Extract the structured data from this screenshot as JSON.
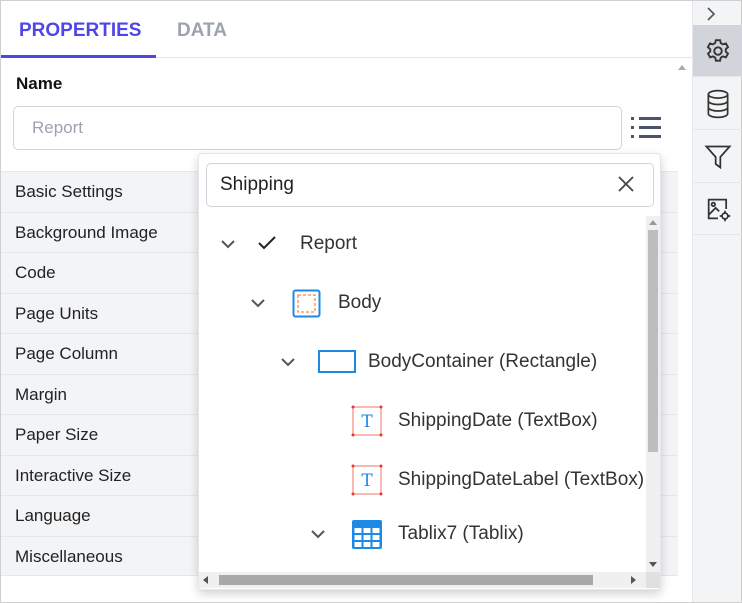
{
  "tabs": [
    {
      "label": "PROPERTIES",
      "active": true
    },
    {
      "label": "DATA",
      "active": false
    }
  ],
  "name_section": {
    "label": "Name",
    "input_placeholder": "Report"
  },
  "property_categories": [
    "Basic Settings",
    "Background Image",
    "Code",
    "Page Units",
    "Page Column",
    "Margin",
    "Paper Size",
    "Interactive Size",
    "Language",
    "Miscellaneous"
  ],
  "sidebar_icons": [
    "chevron-right-icon",
    "gear-icon",
    "database-icon",
    "filter-icon",
    "image-settings-icon"
  ],
  "item_picker": {
    "search_value": "Shipping",
    "tree": [
      {
        "label": "Report",
        "icon": "check-icon",
        "level": 0,
        "expanded": true
      },
      {
        "label": "Body",
        "icon": "body-icon",
        "level": 1,
        "expanded": true
      },
      {
        "label": "BodyContainer (Rectangle)",
        "icon": "rectangle-icon",
        "level": 2,
        "expanded": true
      },
      {
        "label": "ShippingDate (TextBox)",
        "icon": "textbox-icon",
        "level": 3
      },
      {
        "label": "ShippingDateLabel (TextBox)",
        "icon": "textbox-icon",
        "level": 3
      },
      {
        "label": "Tablix7 (Tablix)",
        "icon": "tablix-icon",
        "level": 3,
        "expanded": true
      }
    ]
  },
  "colors": {
    "accent": "#4f46e5",
    "icon_blue": "#1e88e5",
    "textbox_border": "#f28b82"
  }
}
